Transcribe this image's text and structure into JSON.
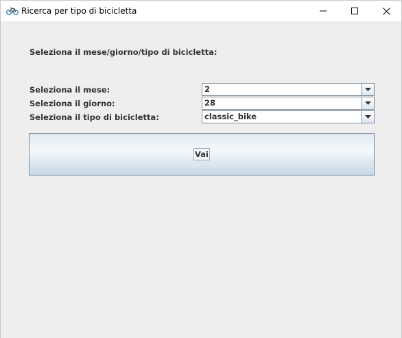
{
  "window": {
    "title": "Ricerca per tipo di bicicletta",
    "icon": "bicycle-icon",
    "controls": [
      "minimize-icon",
      "maximize-icon",
      "close-icon"
    ]
  },
  "form": {
    "heading": "Seleziona il mese/giorno/tipo di bicicletta:",
    "month": {
      "label": "Seleziona il mese:",
      "value": "2"
    },
    "day": {
      "label": "Seleziona il giorno:",
      "value": "28"
    },
    "bike_type": {
      "label": "Seleziona il tipo di bicicletta:",
      "value": "classic_bike"
    },
    "submit_label": "Vai"
  },
  "colors": {
    "background": "#eeeeee",
    "border": "#7a8a99",
    "text": "#333333",
    "bike_icon": "#2a7db8"
  }
}
